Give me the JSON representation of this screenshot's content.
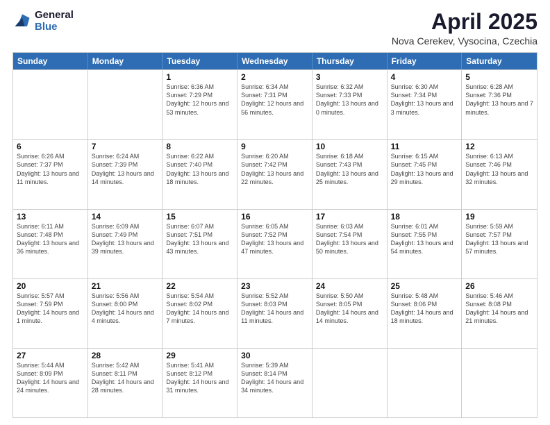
{
  "logo": {
    "general": "General",
    "blue": "Blue"
  },
  "title": "April 2025",
  "subtitle": "Nova Cerekev, Vysocina, Czechia",
  "header_days": [
    "Sunday",
    "Monday",
    "Tuesday",
    "Wednesday",
    "Thursday",
    "Friday",
    "Saturday"
  ],
  "weeks": [
    [
      {
        "day": "",
        "info": ""
      },
      {
        "day": "",
        "info": ""
      },
      {
        "day": "1",
        "info": "Sunrise: 6:36 AM\nSunset: 7:29 PM\nDaylight: 12 hours and 53 minutes."
      },
      {
        "day": "2",
        "info": "Sunrise: 6:34 AM\nSunset: 7:31 PM\nDaylight: 12 hours and 56 minutes."
      },
      {
        "day": "3",
        "info": "Sunrise: 6:32 AM\nSunset: 7:33 PM\nDaylight: 13 hours and 0 minutes."
      },
      {
        "day": "4",
        "info": "Sunrise: 6:30 AM\nSunset: 7:34 PM\nDaylight: 13 hours and 3 minutes."
      },
      {
        "day": "5",
        "info": "Sunrise: 6:28 AM\nSunset: 7:36 PM\nDaylight: 13 hours and 7 minutes."
      }
    ],
    [
      {
        "day": "6",
        "info": "Sunrise: 6:26 AM\nSunset: 7:37 PM\nDaylight: 13 hours and 11 minutes."
      },
      {
        "day": "7",
        "info": "Sunrise: 6:24 AM\nSunset: 7:39 PM\nDaylight: 13 hours and 14 minutes."
      },
      {
        "day": "8",
        "info": "Sunrise: 6:22 AM\nSunset: 7:40 PM\nDaylight: 13 hours and 18 minutes."
      },
      {
        "day": "9",
        "info": "Sunrise: 6:20 AM\nSunset: 7:42 PM\nDaylight: 13 hours and 22 minutes."
      },
      {
        "day": "10",
        "info": "Sunrise: 6:18 AM\nSunset: 7:43 PM\nDaylight: 13 hours and 25 minutes."
      },
      {
        "day": "11",
        "info": "Sunrise: 6:15 AM\nSunset: 7:45 PM\nDaylight: 13 hours and 29 minutes."
      },
      {
        "day": "12",
        "info": "Sunrise: 6:13 AM\nSunset: 7:46 PM\nDaylight: 13 hours and 32 minutes."
      }
    ],
    [
      {
        "day": "13",
        "info": "Sunrise: 6:11 AM\nSunset: 7:48 PM\nDaylight: 13 hours and 36 minutes."
      },
      {
        "day": "14",
        "info": "Sunrise: 6:09 AM\nSunset: 7:49 PM\nDaylight: 13 hours and 39 minutes."
      },
      {
        "day": "15",
        "info": "Sunrise: 6:07 AM\nSunset: 7:51 PM\nDaylight: 13 hours and 43 minutes."
      },
      {
        "day": "16",
        "info": "Sunrise: 6:05 AM\nSunset: 7:52 PM\nDaylight: 13 hours and 47 minutes."
      },
      {
        "day": "17",
        "info": "Sunrise: 6:03 AM\nSunset: 7:54 PM\nDaylight: 13 hours and 50 minutes."
      },
      {
        "day": "18",
        "info": "Sunrise: 6:01 AM\nSunset: 7:55 PM\nDaylight: 13 hours and 54 minutes."
      },
      {
        "day": "19",
        "info": "Sunrise: 5:59 AM\nSunset: 7:57 PM\nDaylight: 13 hours and 57 minutes."
      }
    ],
    [
      {
        "day": "20",
        "info": "Sunrise: 5:57 AM\nSunset: 7:59 PM\nDaylight: 14 hours and 1 minute."
      },
      {
        "day": "21",
        "info": "Sunrise: 5:56 AM\nSunset: 8:00 PM\nDaylight: 14 hours and 4 minutes."
      },
      {
        "day": "22",
        "info": "Sunrise: 5:54 AM\nSunset: 8:02 PM\nDaylight: 14 hours and 7 minutes."
      },
      {
        "day": "23",
        "info": "Sunrise: 5:52 AM\nSunset: 8:03 PM\nDaylight: 14 hours and 11 minutes."
      },
      {
        "day": "24",
        "info": "Sunrise: 5:50 AM\nSunset: 8:05 PM\nDaylight: 14 hours and 14 minutes."
      },
      {
        "day": "25",
        "info": "Sunrise: 5:48 AM\nSunset: 8:06 PM\nDaylight: 14 hours and 18 minutes."
      },
      {
        "day": "26",
        "info": "Sunrise: 5:46 AM\nSunset: 8:08 PM\nDaylight: 14 hours and 21 minutes."
      }
    ],
    [
      {
        "day": "27",
        "info": "Sunrise: 5:44 AM\nSunset: 8:09 PM\nDaylight: 14 hours and 24 minutes."
      },
      {
        "day": "28",
        "info": "Sunrise: 5:42 AM\nSunset: 8:11 PM\nDaylight: 14 hours and 28 minutes."
      },
      {
        "day": "29",
        "info": "Sunrise: 5:41 AM\nSunset: 8:12 PM\nDaylight: 14 hours and 31 minutes."
      },
      {
        "day": "30",
        "info": "Sunrise: 5:39 AM\nSunset: 8:14 PM\nDaylight: 14 hours and 34 minutes."
      },
      {
        "day": "",
        "info": ""
      },
      {
        "day": "",
        "info": ""
      },
      {
        "day": "",
        "info": ""
      }
    ]
  ]
}
